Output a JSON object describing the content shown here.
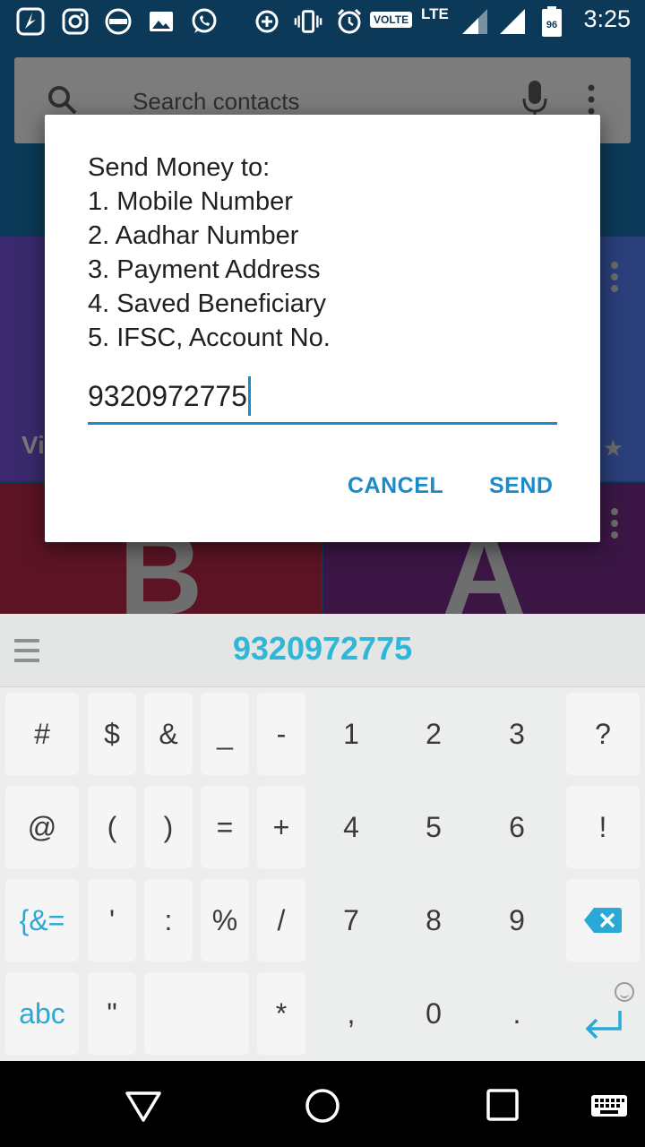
{
  "status_bar": {
    "time": "3:25",
    "volte_label": "VOLTE",
    "network_label": "LTE",
    "battery_level": "96",
    "icons": [
      "app-shortcut-icon",
      "instagram-icon",
      "chat-app-icon",
      "gallery-icon",
      "whatsapp-icon",
      "data-saver-icon",
      "vibrate-icon",
      "alarm-icon",
      "volte-icon",
      "signal-icon",
      "signal-icon",
      "battery-icon"
    ]
  },
  "background_app": {
    "search_placeholder": "Search contacts",
    "tiles": [
      {
        "letter": "",
        "partial_text": "Vi",
        "color": "#3a2a6d"
      },
      {
        "letter": "",
        "partial_text": "",
        "color": "#2b3f7a"
      },
      {
        "letter": "B",
        "partial_text": "",
        "color": "#5c1424"
      },
      {
        "letter": "A",
        "partial_text": "",
        "color": "#3b1645"
      }
    ]
  },
  "dialog": {
    "message_lines": [
      "Send Money to:",
      "1. Mobile Number",
      "2. Aadhar Number",
      "3. Payment Address",
      "4. Saved Beneficiary",
      "5. IFSC, Account No."
    ],
    "input_value": "9320972775",
    "cancel_label": "CANCEL",
    "send_label": "SEND"
  },
  "keyboard": {
    "suggestion": "9320972775",
    "rows": [
      [
        "#",
        "$",
        "&",
        "_",
        "-",
        "1",
        "2",
        "3",
        "?"
      ],
      [
        "@",
        "(",
        ")",
        "=",
        "+",
        "4",
        "5",
        "6",
        "!"
      ],
      [
        "{&=",
        "'",
        ":",
        "%",
        "/",
        "7",
        "8",
        "9",
        "backspace"
      ],
      [
        "abc",
        "\"",
        "space",
        "*",
        ",",
        "0",
        ".",
        "enter"
      ]
    ]
  },
  "colors": {
    "accent": "#1c8ac9",
    "keyboard_accent": "#2fb6d8",
    "status_bar": "#0c3957"
  }
}
